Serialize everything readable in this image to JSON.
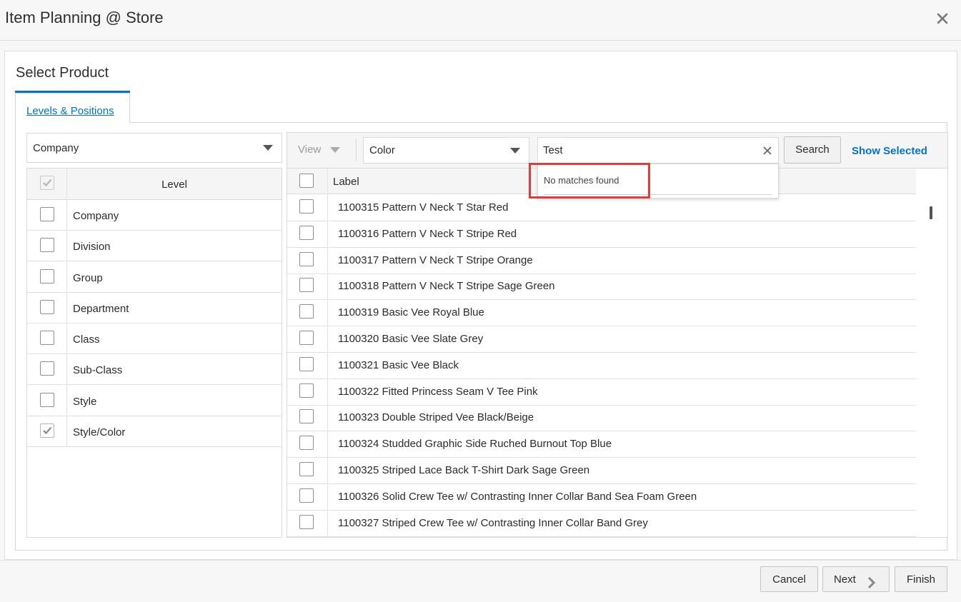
{
  "dialog": {
    "title": "Item Planning @ Store",
    "close_icon": "close-icon"
  },
  "card": {
    "title": "Select Product",
    "tab_label": "Levels & Positions"
  },
  "left": {
    "hierarchy_select": "Company",
    "level_header": "Level",
    "levels": [
      {
        "label": "Company",
        "checked": false
      },
      {
        "label": "Division",
        "checked": false
      },
      {
        "label": "Group",
        "checked": false
      },
      {
        "label": "Department",
        "checked": false
      },
      {
        "label": "Class",
        "checked": false
      },
      {
        "label": "Sub-Class",
        "checked": false
      },
      {
        "label": "Style",
        "checked": false
      },
      {
        "label": "Style/Color",
        "checked": true
      }
    ]
  },
  "right": {
    "view_label": "View",
    "level_select": "Color",
    "search_value": "Test",
    "search_button": "Search",
    "show_selected": "Show Selected",
    "no_matches": "No matches found",
    "column_header": "Label",
    "items": [
      "1100315 Pattern V Neck T Star Red",
      "1100316 Pattern V Neck T Stripe Red",
      "1100317 Pattern V Neck T Stripe Orange",
      "1100318 Pattern V Neck T Stripe Sage Green",
      "1100319 Basic Vee Royal Blue",
      "1100320 Basic Vee Slate Grey",
      "1100321 Basic Vee Black",
      "1100322 Fitted Princess Seam V Tee Pink",
      "1100323 Double Striped Vee Black/Beige",
      "1100324 Studded Graphic Side Ruched Burnout Top Blue",
      "1100325 Striped Lace Back T-Shirt Dark Sage Green",
      "1100326 Solid Crew Tee w/ Contrasting Inner Collar Band Sea Foam Green",
      "1100327 Striped Crew Tee w/ Contrasting Inner Collar Band Grey"
    ]
  },
  "footer": {
    "cancel": "Cancel",
    "next": "Next",
    "finish": "Finish"
  },
  "colors": {
    "accent": "#0572ce",
    "highlight": "#e23b3b"
  }
}
